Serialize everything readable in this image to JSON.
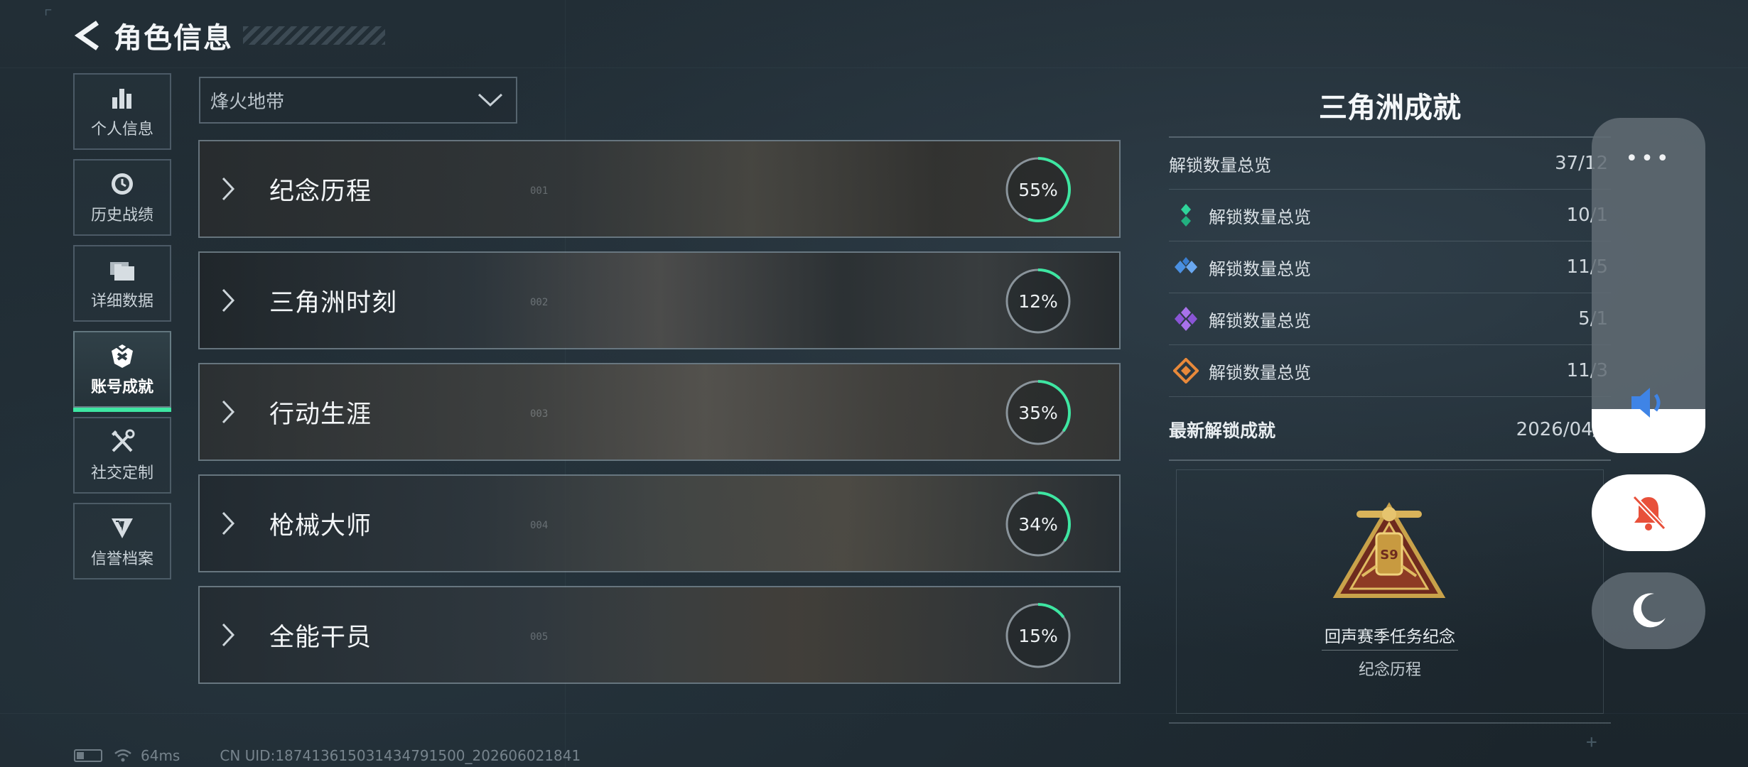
{
  "header": {
    "title": "角色信息"
  },
  "sidebar": {
    "items": [
      {
        "label": "个人信息",
        "icon": "bar-chart-icon",
        "active": false
      },
      {
        "label": "历史战绩",
        "icon": "history-clock-icon",
        "active": false
      },
      {
        "label": "详细数据",
        "icon": "folder-stack-icon",
        "active": false
      },
      {
        "label": "账号成就",
        "icon": "achievement-badge-icon",
        "active": true
      },
      {
        "label": "社交定制",
        "icon": "tools-icon",
        "active": false
      },
      {
        "label": "信誉档案",
        "icon": "credit-shield-icon",
        "active": false
      }
    ]
  },
  "mode_select": {
    "value": "烽火地带"
  },
  "categories": [
    {
      "name": "纪念历程",
      "number": "001",
      "progress_label": "55%",
      "progress": 0.55
    },
    {
      "name": "三角洲时刻",
      "number": "002",
      "progress_label": "12%",
      "progress": 0.12
    },
    {
      "name": "行动生涯",
      "number": "003",
      "progress_label": "35%",
      "progress": 0.35
    },
    {
      "name": "枪械大师",
      "number": "004",
      "progress_label": "34%",
      "progress": 0.34
    },
    {
      "name": "全能干员",
      "number": "005",
      "progress_label": "15%",
      "progress": 0.15
    }
  ],
  "achievements": {
    "title": "三角洲成就",
    "total": {
      "label": "解锁数量总览",
      "value": "37/12"
    },
    "tiers": [
      {
        "label": "解锁数量总览",
        "value": "10/1",
        "color": "#2fd39a",
        "icon": "green-gem-icon"
      },
      {
        "label": "解锁数量总览",
        "value": "11/5",
        "color": "#4a90e2",
        "icon": "blue-gem-icon"
      },
      {
        "label": "解锁数量总览",
        "value": "5/1",
        "color": "#9a62e0",
        "icon": "purple-gem-icon"
      },
      {
        "label": "解锁数量总览",
        "value": "11/3",
        "color": "#e8893a",
        "icon": "orange-gem-icon"
      }
    ],
    "latest": {
      "label": "最新解锁成就",
      "date": "2026/04/2",
      "badge_name": "回声赛季任务纪念",
      "badge_category": "纪念历程",
      "badge_text": "S9"
    }
  },
  "float_controls": {
    "menu_dots": "•••",
    "volume_level": 0.13
  },
  "footer": {
    "ping": "64ms",
    "uid": "CN UID:187413615031434791500_202606021841"
  },
  "colors": {
    "accent": "#3ee6a2",
    "ring_track": "#8a949b"
  }
}
